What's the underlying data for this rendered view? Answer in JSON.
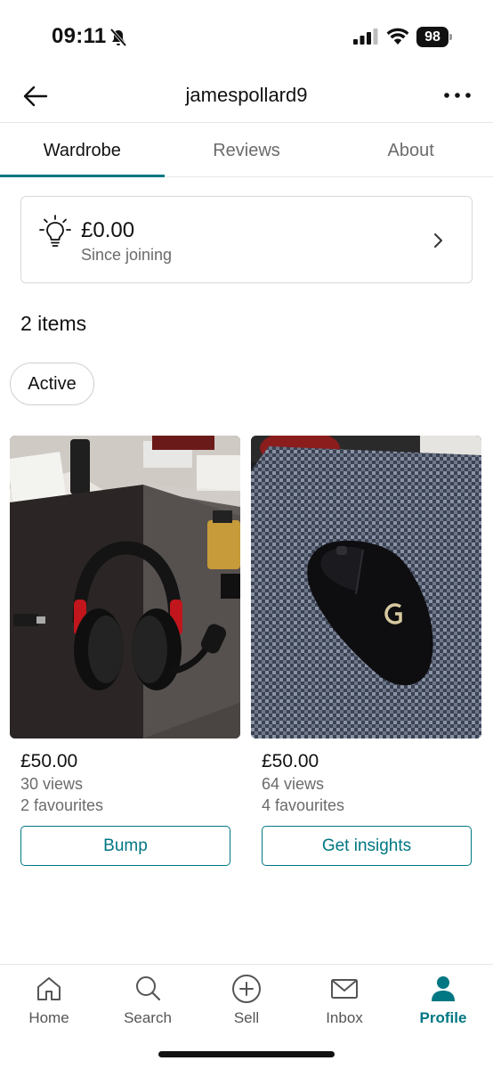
{
  "status_bar": {
    "time": "09:11",
    "battery": "98",
    "icons": [
      "bell-off-icon",
      "signal-icon",
      "wifi-icon",
      "battery-icon"
    ]
  },
  "header": {
    "title": "jamespollard9",
    "back_icon": "arrow-left-icon",
    "more_icon": "more-dots-icon"
  },
  "tabs": [
    {
      "label": "Wardrobe",
      "active": true
    },
    {
      "label": "Reviews",
      "active": false
    },
    {
      "label": "About",
      "active": false
    }
  ],
  "balance": {
    "amount": "£0.00",
    "caption": "Since joining",
    "icon": "lightbulb-icon"
  },
  "items_count": "2 items",
  "filter_chip": "Active",
  "products": [
    {
      "price": "£50.00",
      "views": "30 views",
      "favourites": "2 favourites",
      "action": "Bump",
      "photo": "headset-photo"
    },
    {
      "price": "£50.00",
      "views": "64 views",
      "favourites": "4 favourites",
      "action": "Get insights",
      "photo": "mouse-photo"
    }
  ],
  "nav": [
    {
      "label": "Home",
      "icon": "home-icon",
      "active": false
    },
    {
      "label": "Search",
      "icon": "search-icon",
      "active": false
    },
    {
      "label": "Sell",
      "icon": "plus-circle-icon",
      "active": false
    },
    {
      "label": "Inbox",
      "icon": "mail-icon",
      "active": false
    },
    {
      "label": "Profile",
      "icon": "person-icon",
      "active": true
    }
  ],
  "colors": {
    "accent": "#007782",
    "text_primary": "#111111",
    "text_secondary": "#6b6b6b",
    "border": "#d9d9d9"
  }
}
